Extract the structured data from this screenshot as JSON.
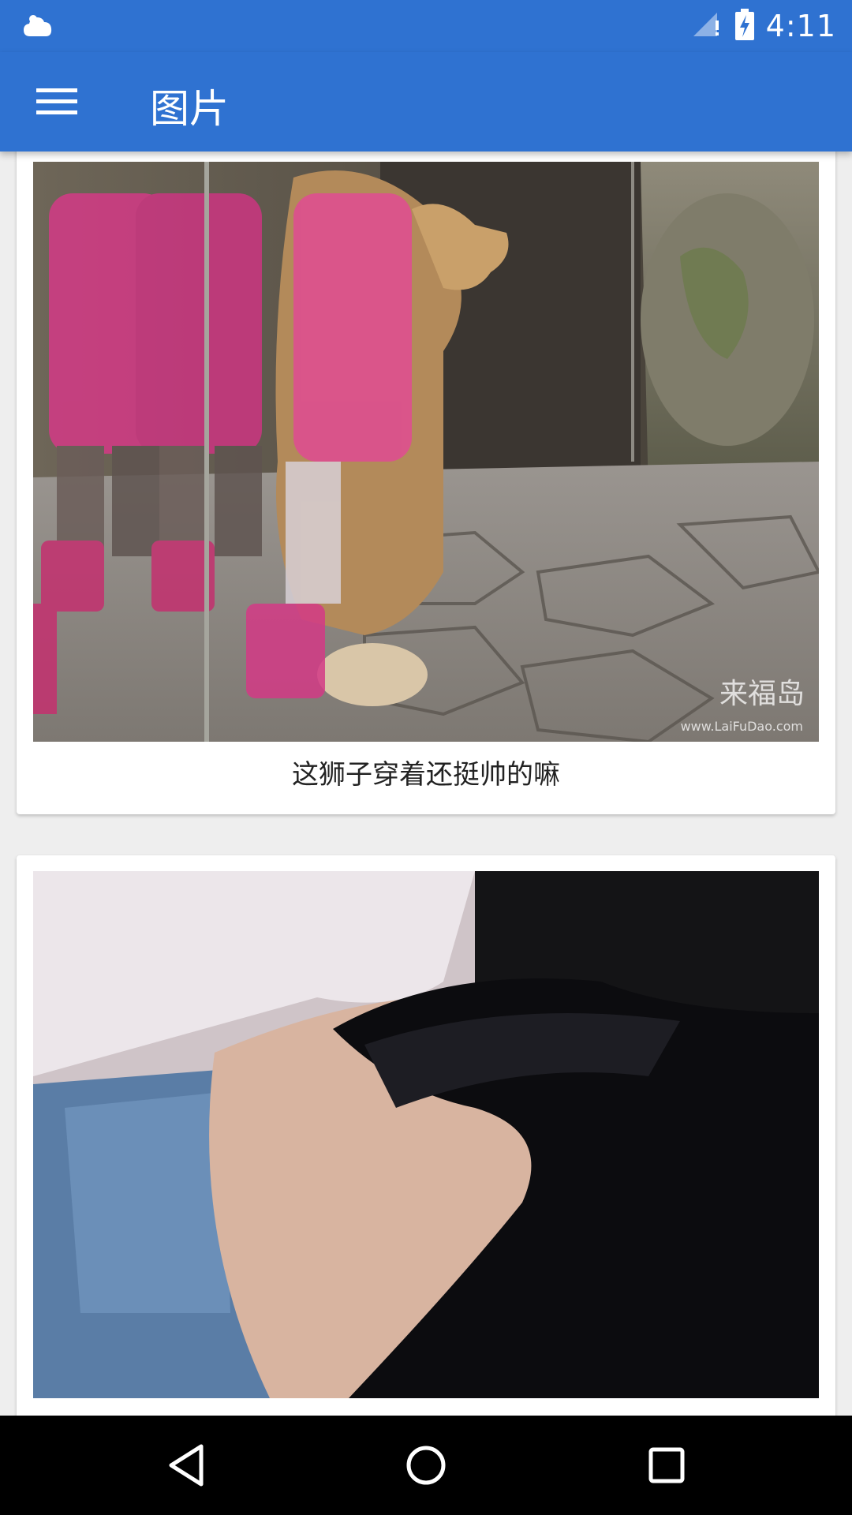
{
  "status_bar": {
    "time": "4:11",
    "icons": [
      "cloud-icon",
      "signal-icon",
      "battery-charging-icon"
    ]
  },
  "app_bar": {
    "title": "图片",
    "menu_icon": "hamburger-menu-icon"
  },
  "feed": {
    "items": [
      {
        "caption": "这狮子穿着还挺帅的嘛",
        "watermark": "来福岛",
        "watermark_url": "www.LaiFuDao.com"
      },
      {
        "caption": ""
      }
    ]
  },
  "nav_bar": {
    "buttons": [
      "back-icon",
      "home-icon",
      "recents-icon"
    ]
  },
  "colors": {
    "primary": "#2f72d1",
    "background": "#eeeeee"
  }
}
